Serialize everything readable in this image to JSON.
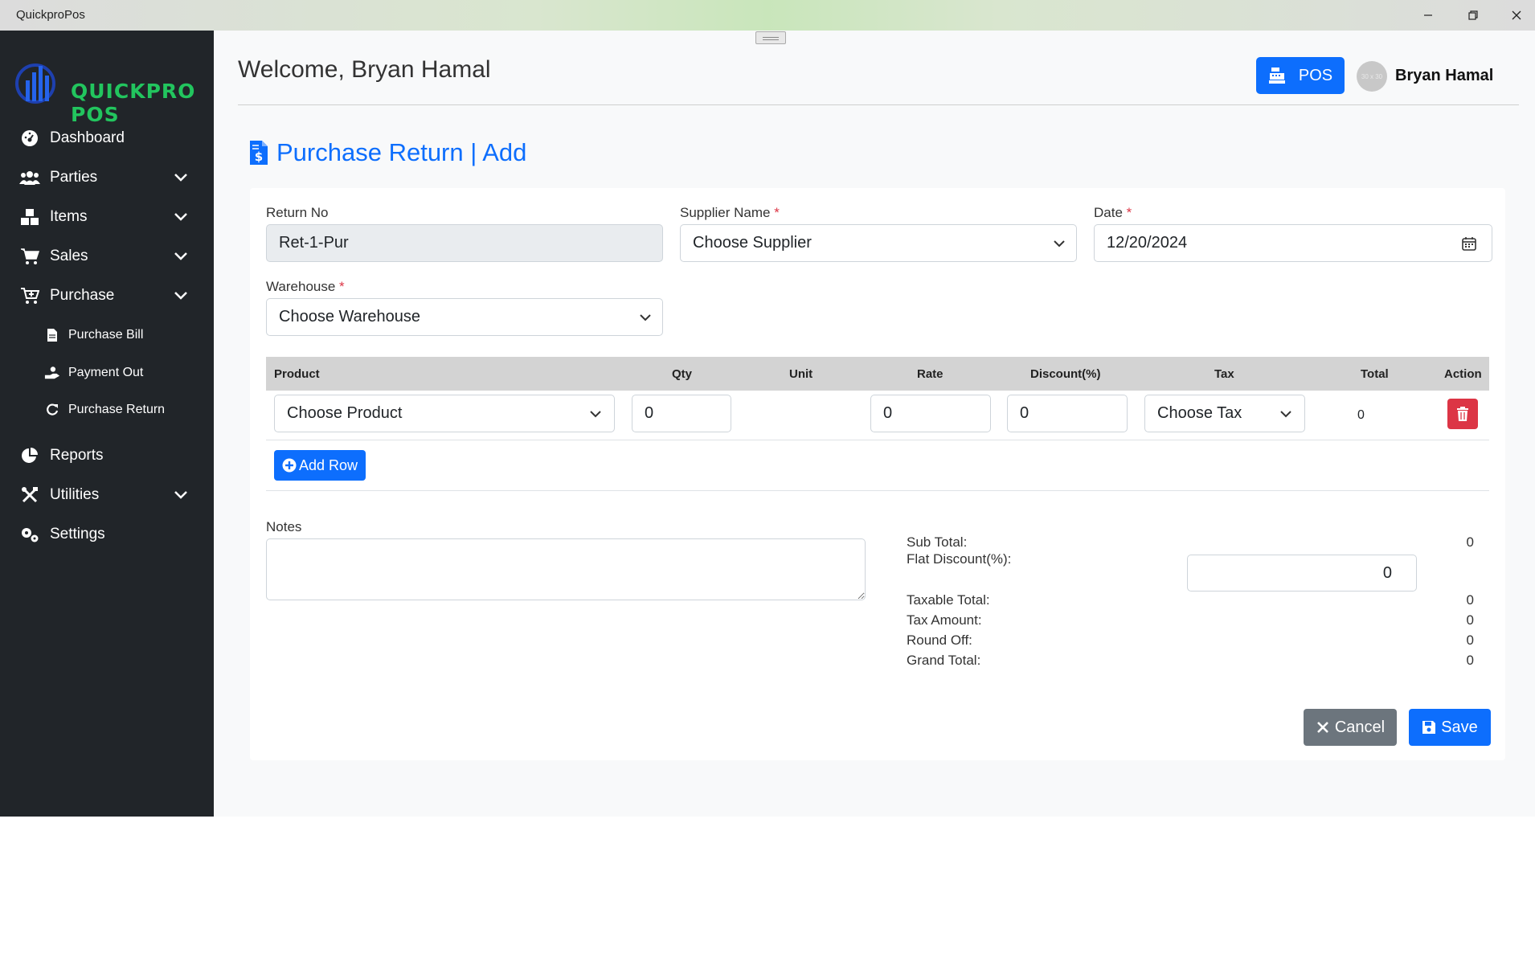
{
  "window": {
    "title": "QuickproPos"
  },
  "brand": {
    "logo_text": "QUICKPRO POS",
    "accent_color": "#22c55e"
  },
  "sidebar": {
    "items": [
      {
        "label": "Dashboard",
        "icon": "gauge-icon"
      },
      {
        "label": "Parties",
        "icon": "users-icon"
      },
      {
        "label": "Items",
        "icon": "boxes-icon"
      },
      {
        "label": "Sales",
        "icon": "cart-icon"
      },
      {
        "label": "Purchase",
        "icon": "cart-plus-icon"
      },
      {
        "label": "Reports",
        "icon": "pie-chart-icon"
      },
      {
        "label": "Utilities",
        "icon": "tools-icon"
      },
      {
        "label": "Settings",
        "icon": "gears-icon"
      }
    ],
    "purchase_sub": [
      {
        "label": "Purchase Bill",
        "icon": "file-icon"
      },
      {
        "label": "Payment Out",
        "icon": "hand-coin-icon"
      },
      {
        "label": "Purchase Return",
        "icon": "refresh-icon"
      }
    ]
  },
  "header": {
    "welcome": "Welcome, Bryan Hamal",
    "pos_label": "POS",
    "avatar_placeholder": "30 x 30",
    "user_name": "Bryan Hamal"
  },
  "page": {
    "title": "Purchase Return | Add"
  },
  "form": {
    "return_no_label": "Return No",
    "return_no_value": "Ret-1-Pur",
    "supplier_label": "Supplier Name",
    "supplier_value": "Choose Supplier",
    "date_label": "Date",
    "date_value": "12/20/2024",
    "warehouse_label": "Warehouse",
    "warehouse_value": "Choose Warehouse",
    "required_mark": "*"
  },
  "table": {
    "headers": [
      "Product",
      "Qty",
      "Unit",
      "Rate",
      "Discount(%)",
      "Tax",
      "Total",
      "Action"
    ],
    "rows": [
      {
        "product": "Choose Product",
        "qty": "0",
        "rate": "0",
        "discount": "0",
        "tax": "Choose Tax",
        "total": "0"
      }
    ],
    "add_row_label": "Add Row"
  },
  "notes": {
    "label": "Notes",
    "value": ""
  },
  "summary": {
    "sub_total_label": "Sub Total:",
    "sub_total": "0",
    "flat_discount_label": "Flat Discount(%):",
    "flat_discount": "0",
    "taxable_total_label": "Taxable Total:",
    "taxable_total": "0",
    "tax_amount_label": "Tax Amount:",
    "tax_amount": "0",
    "round_off_label": "Round Off:",
    "round_off": "0",
    "grand_total_label": "Grand Total:",
    "grand_total": "0"
  },
  "actions": {
    "cancel_label": "Cancel",
    "save_label": "Save"
  },
  "colors": {
    "primary": "#0d6efd",
    "danger": "#dc3545",
    "secondary": "#6c757d",
    "sidebar_bg": "#212529"
  }
}
